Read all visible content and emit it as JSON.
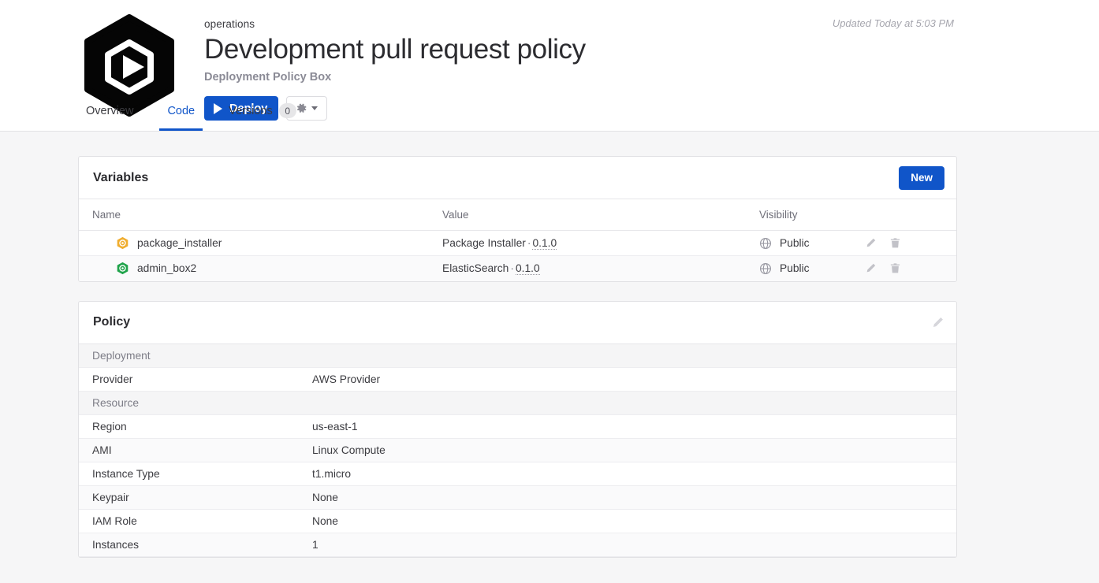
{
  "header": {
    "org": "operations",
    "title": "Development pull request policy",
    "subtitle": "Deployment Policy Box",
    "updated": "Updated Today at 5:03 PM",
    "deploy_label": "Deploy",
    "logo_icon": "play-hexagon-logo",
    "gear_icon": "gear-icon",
    "caret_icon": "chevron-down-icon"
  },
  "tabs": [
    {
      "label": "Overview",
      "active": false,
      "badge": ""
    },
    {
      "label": "Code",
      "active": true,
      "badge": ""
    },
    {
      "label": "Versions",
      "active": false,
      "badge": "0"
    }
  ],
  "variables_card": {
    "title": "Variables",
    "new_label": "New",
    "columns": [
      "Name",
      "Value",
      "Visibility"
    ],
    "rows": [
      {
        "icon": "hexagon-badge-orange",
        "icon_color": "#f0ad2e",
        "name": "package_installer",
        "value_name": "Package Installer",
        "value_sep": "·",
        "value_version": "0.1.0",
        "visibility": "Public",
        "visibility_icon": "globe-icon",
        "edit_icon": "pencil-icon",
        "delete_icon": "trash-icon"
      },
      {
        "icon": "hexagon-badge-green",
        "icon_color": "#1fa34a",
        "name": "admin_box2",
        "value_name": "ElasticSearch",
        "value_sep": "·",
        "value_version": "0.1.0",
        "visibility": "Public",
        "visibility_icon": "globe-icon",
        "edit_icon": "pencil-icon",
        "delete_icon": "trash-icon"
      }
    ]
  },
  "policy_card": {
    "title": "Policy",
    "edit_icon": "pencil-icon",
    "rows": [
      {
        "type": "section",
        "key": "Deployment",
        "value": ""
      },
      {
        "type": "row",
        "key": "Provider",
        "value": "AWS Provider"
      },
      {
        "type": "section",
        "key": "Resource",
        "value": ""
      },
      {
        "type": "row",
        "key": "Region",
        "value": "us-east-1"
      },
      {
        "type": "row",
        "key": "AMI",
        "value": "Linux Compute"
      },
      {
        "type": "row",
        "key": "Instance Type",
        "value": "t1.micro"
      },
      {
        "type": "row",
        "key": "Keypair",
        "value": "None"
      },
      {
        "type": "row",
        "key": "IAM Role",
        "value": "None"
      },
      {
        "type": "row",
        "key": "Instances",
        "value": "1"
      }
    ]
  },
  "colors": {
    "accent": "#1055c9",
    "page_bg": "#f6f6f7",
    "card_bg": "#ffffff",
    "border": "#e1e1e4",
    "text": "#3c3c41",
    "muted": "#8b8b96"
  }
}
